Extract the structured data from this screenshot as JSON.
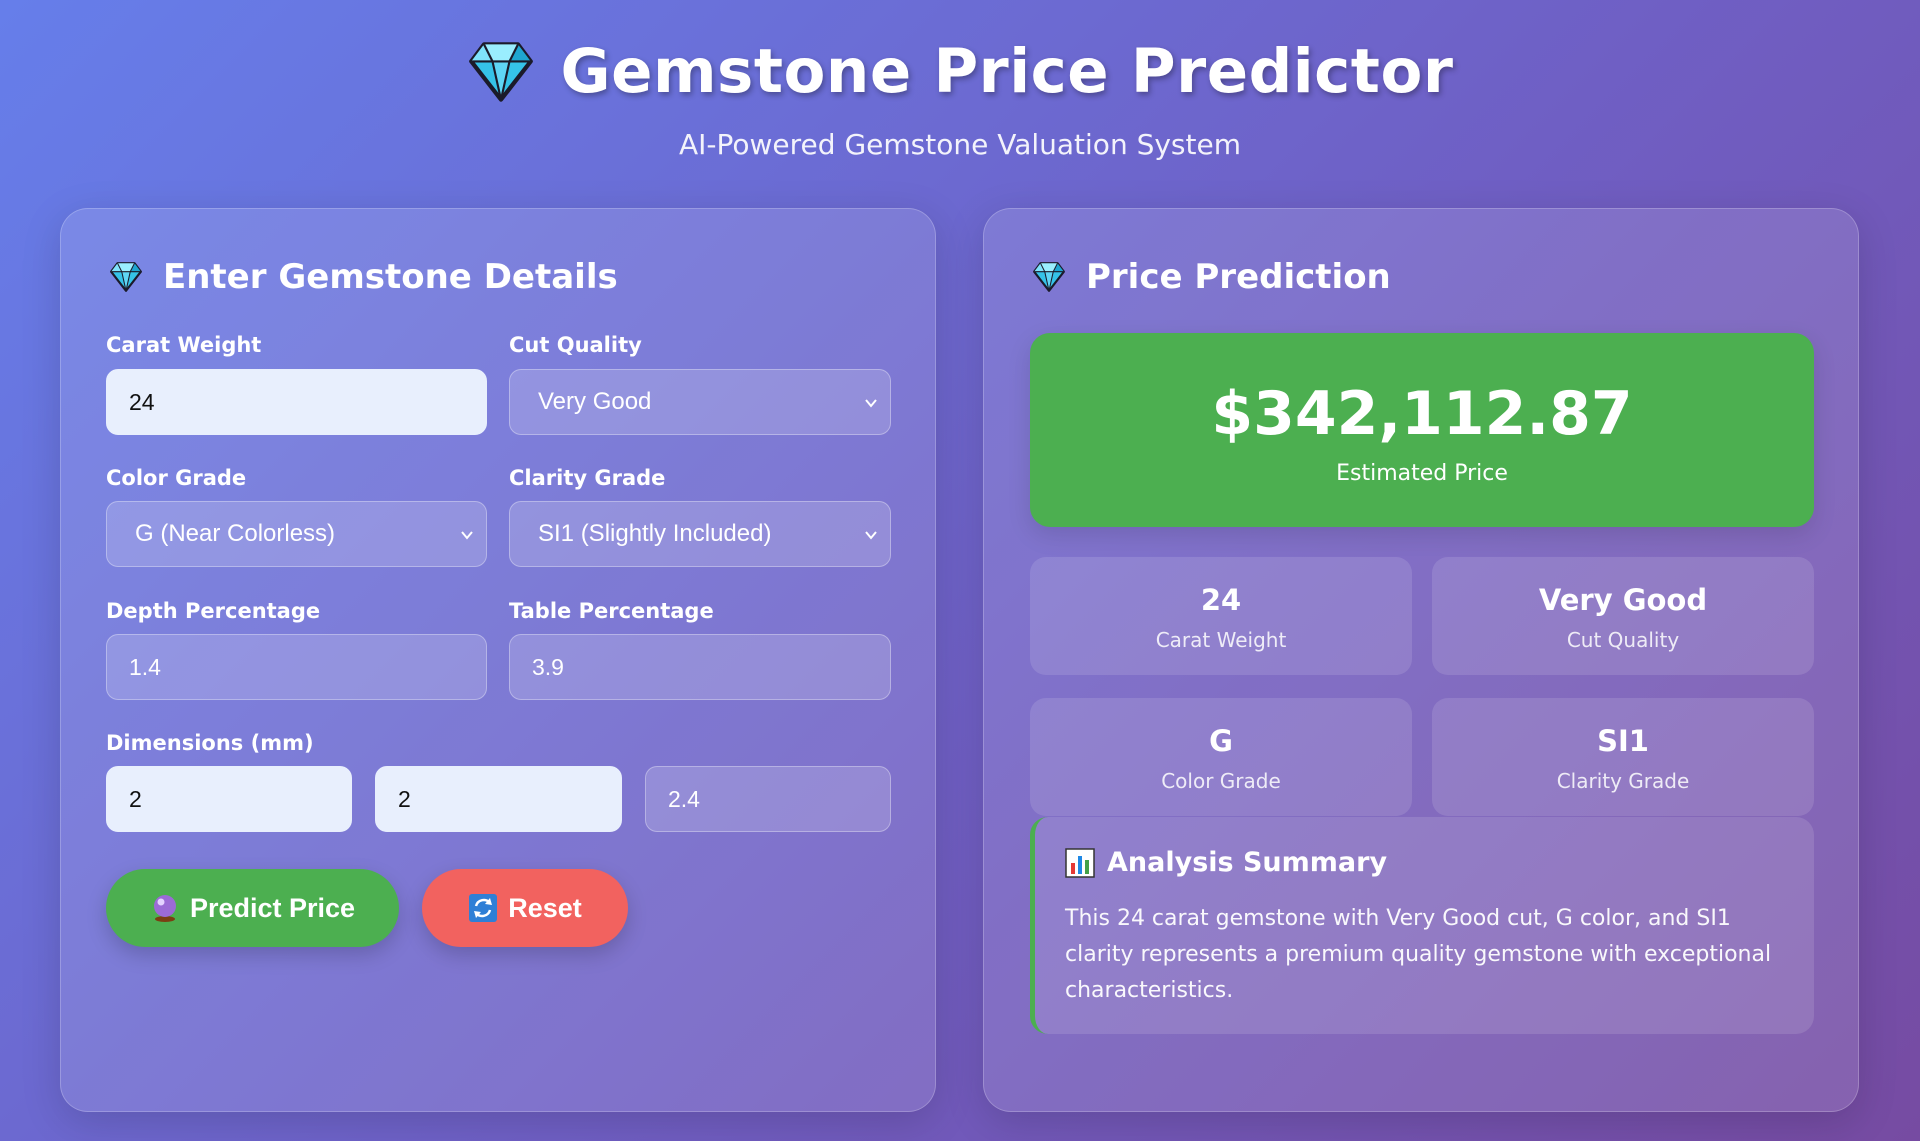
{
  "header": {
    "title": "Gemstone Price Predictor",
    "subtitle": "AI-Powered Gemstone Valuation System"
  },
  "form": {
    "title": "Enter Gemstone Details",
    "carat": {
      "label": "Carat Weight",
      "value": "24"
    },
    "cut": {
      "label": "Cut Quality",
      "value": "Very Good"
    },
    "color": {
      "label": "Color Grade",
      "value": "G (Near Colorless)"
    },
    "clarity": {
      "label": "Clarity Grade",
      "value": "SI1 (Slightly Included)"
    },
    "depth": {
      "label": "Depth Percentage",
      "value": "1.4"
    },
    "table": {
      "label": "Table Percentage",
      "value": "3.9"
    },
    "dimensions": {
      "label": "Dimensions (mm)",
      "x": "2",
      "y": "2",
      "z": "2.4"
    },
    "predict_label": "Predict Price",
    "reset_label": "Reset"
  },
  "prediction": {
    "title": "Price Prediction",
    "price": "$342,112.87",
    "price_label": "Estimated Price",
    "stats": [
      {
        "value": "24",
        "label": "Carat Weight"
      },
      {
        "value": "Very Good",
        "label": "Cut Quality"
      },
      {
        "value": "G",
        "label": "Color Grade"
      },
      {
        "value": "SI1",
        "label": "Clarity Grade"
      }
    ],
    "summary_title": "Analysis Summary",
    "summary_text": "This 24 carat gemstone with Very Good cut, G color, and SI1 clarity represents a premium quality gemstone with exceptional characteristics."
  },
  "colors": {
    "accent_green": "#4caf50",
    "reset_red": "#f2625f",
    "bg_start": "#667eea",
    "bg_end": "#764ba2"
  },
  "icons": {
    "title": "gem-icon",
    "predict": "crystal-ball-icon",
    "reset": "refresh-icon",
    "summary": "bar-chart-icon",
    "select": "chevron-down-icon"
  }
}
